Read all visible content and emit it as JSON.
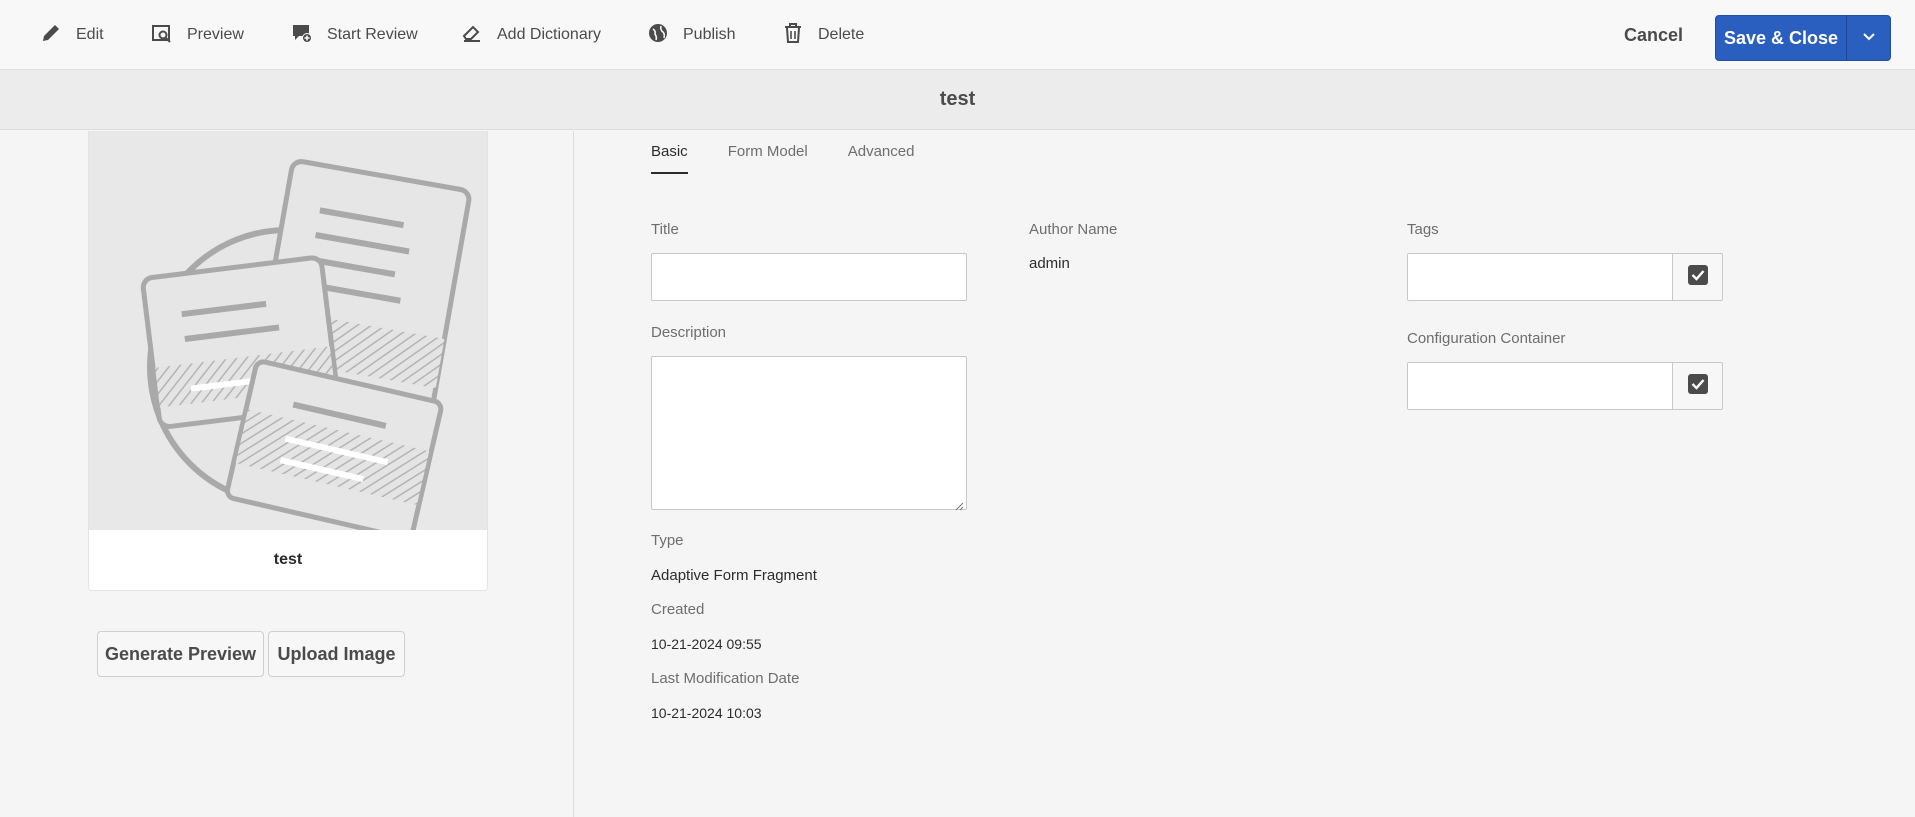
{
  "toolbar": {
    "edit": "Edit",
    "preview": "Preview",
    "start_review": "Start Review",
    "add_dictionary": "Add Dictionary",
    "publish": "Publish",
    "delete": "Delete",
    "cancel": "Cancel",
    "save_close": "Save & Close"
  },
  "page_title": "test",
  "card": {
    "title": "test"
  },
  "left_buttons": {
    "generate_preview": "Generate Preview",
    "upload_image": "Upload Image"
  },
  "tabs": [
    "Basic",
    "Form Model",
    "Advanced"
  ],
  "active_tab": "Basic",
  "form": {
    "title_label": "Title",
    "title_value": "",
    "description_label": "Description",
    "description_value": "",
    "author_label": "Author Name",
    "author_value": "admin",
    "tags_label": "Tags",
    "tags_value": "",
    "config_label": "Configuration Container",
    "config_value": "",
    "type_label": "Type",
    "type_value": "Adaptive Form Fragment",
    "created_label": "Created",
    "created_value": "10-21-2024 09:55",
    "modified_label": "Last Modification Date",
    "modified_value": "10-21-2024 10:03"
  },
  "colors": {
    "primary": "#2a5fc0",
    "icon": "#4b4b4b"
  },
  "icons": [
    "pencil-icon",
    "preview-icon",
    "review-icon",
    "dictionary-icon",
    "globe-icon",
    "trash-icon",
    "chevron-down-icon",
    "checkmark-icon"
  ]
}
